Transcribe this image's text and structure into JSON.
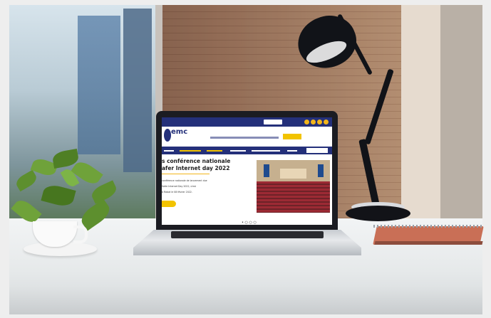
{
  "scene": "laptop on desk",
  "website": {
    "logo": "emc",
    "logo_subtitle": "",
    "tagline": "",
    "cta_label": "",
    "nav": [
      "",
      "",
      "",
      "",
      "",
      ""
    ],
    "headline": [
      "s conférence nationale",
      "afer Internet day 2022"
    ],
    "paragraph": [
      "conférence nationale de lancement due",
      "Safer Internet Day 2022, s'est",
      "à Rabat le 08 février 2022."
    ],
    "slider_dots": "• ○ ○ ○"
  },
  "colors": {
    "site_navy": "#24307a",
    "site_gold": "#f2c300",
    "lamp_black": "#111318",
    "notebook": "#c96f56"
  }
}
